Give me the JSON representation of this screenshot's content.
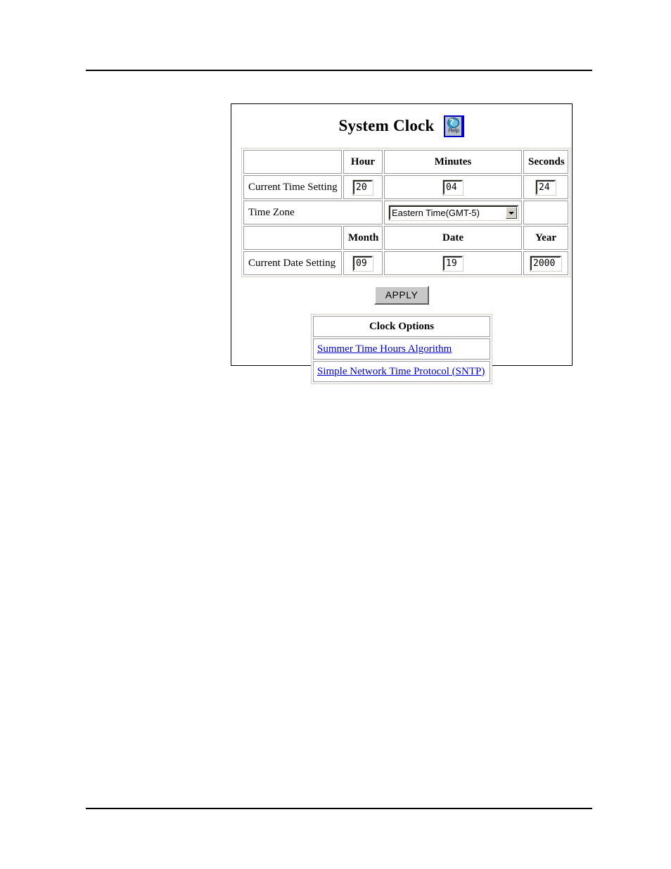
{
  "panel": {
    "title": "System Clock",
    "help_icon": {
      "label": "Help",
      "glyph": "?",
      "border_color": "#0000c8",
      "bubble_color": "#2a8fbd"
    }
  },
  "time_table": {
    "headers_time": [
      "",
      "Hour",
      "Minutes",
      "Seconds"
    ],
    "time_row": {
      "label": "Current Time Setting",
      "hour": "20",
      "minutes": "04",
      "seconds": "24"
    },
    "timezone_row": {
      "label": "Time Zone",
      "selected": "Eastern Time(GMT-5)",
      "options": [
        "Eastern Time(GMT-5)"
      ]
    },
    "headers_date": [
      "",
      "Month",
      "Date",
      "Year"
    ],
    "date_row": {
      "label": "Current Date Setting",
      "month": "09",
      "date": "19",
      "year": "2000"
    }
  },
  "apply": {
    "label": "APPLY"
  },
  "clock_options": {
    "header": "Clock Options",
    "links": [
      "Summer Time Hours Algorithm",
      "Simple Network Time Protocol (SNTP)"
    ],
    "link_color": "#0000cc"
  }
}
